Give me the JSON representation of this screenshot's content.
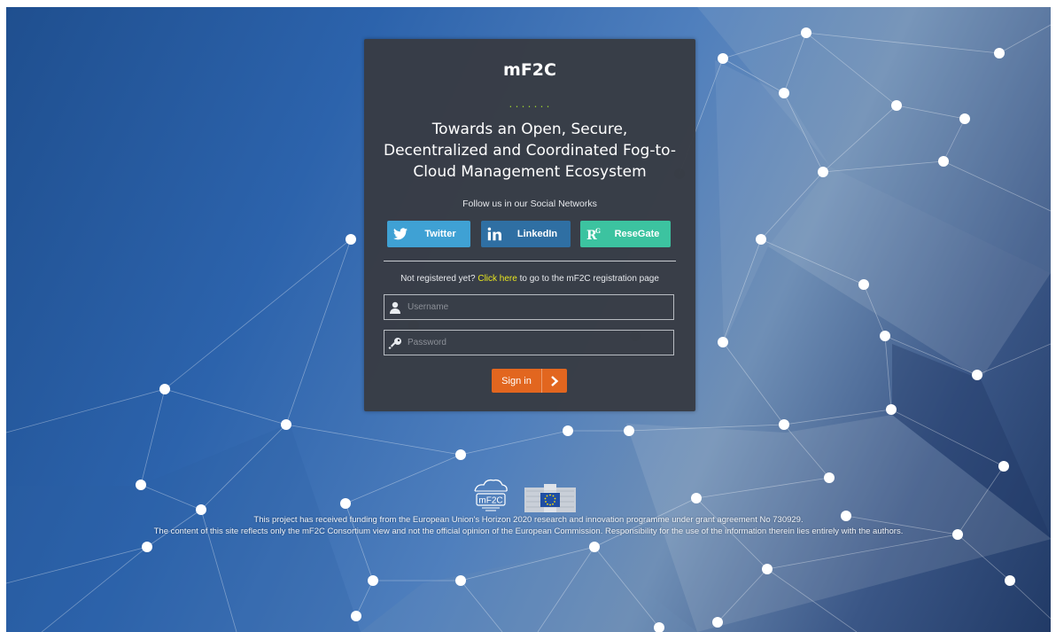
{
  "card": {
    "brand": "mF2C",
    "dots": ".......",
    "tagline_lines": [
      "Towards an Open, Secure,",
      "Decentralized and Coordinated Fog-to-",
      "Cloud Management Ecosystem"
    ],
    "social_caption": "Follow us in our Social Networks",
    "social": {
      "twitter": "Twitter",
      "linkedin": "LinkedIn",
      "resegate": "ReseGate"
    },
    "register": {
      "prefix": "Not registered yet? ",
      "link": "Click here",
      "suffix": " to go to the mF2C registration page"
    },
    "username_placeholder": "Username",
    "password_placeholder": "Password",
    "signin_label": "Sign in"
  },
  "logos": {
    "mf2c_text": "mF2C"
  },
  "footer": {
    "line1": "This project has received funding from the European Union's Horizon 2020 research and innovation programme under grant agreement No 730929.",
    "line2": "The content of this site reflects only the mF2C Consortium view and not the official opinion of the European Commission. Responsibility for the use of the information therein lies entirely with the authors."
  },
  "colors": {
    "card_bg": "#383c44",
    "twitter": "#3fa1d4",
    "linkedin": "#2f6fa3",
    "resegate": "#3cc3a0",
    "signin": "#e2661f",
    "link": "#e8e620",
    "accent_dots": "#9acd32"
  },
  "icons": {
    "twitter": "twitter-bird-icon",
    "linkedin": "linkedin-icon",
    "resegate": "researchgate-icon",
    "username": "user-icon",
    "password": "key-icon",
    "signin": "chevron-right-icon"
  }
}
